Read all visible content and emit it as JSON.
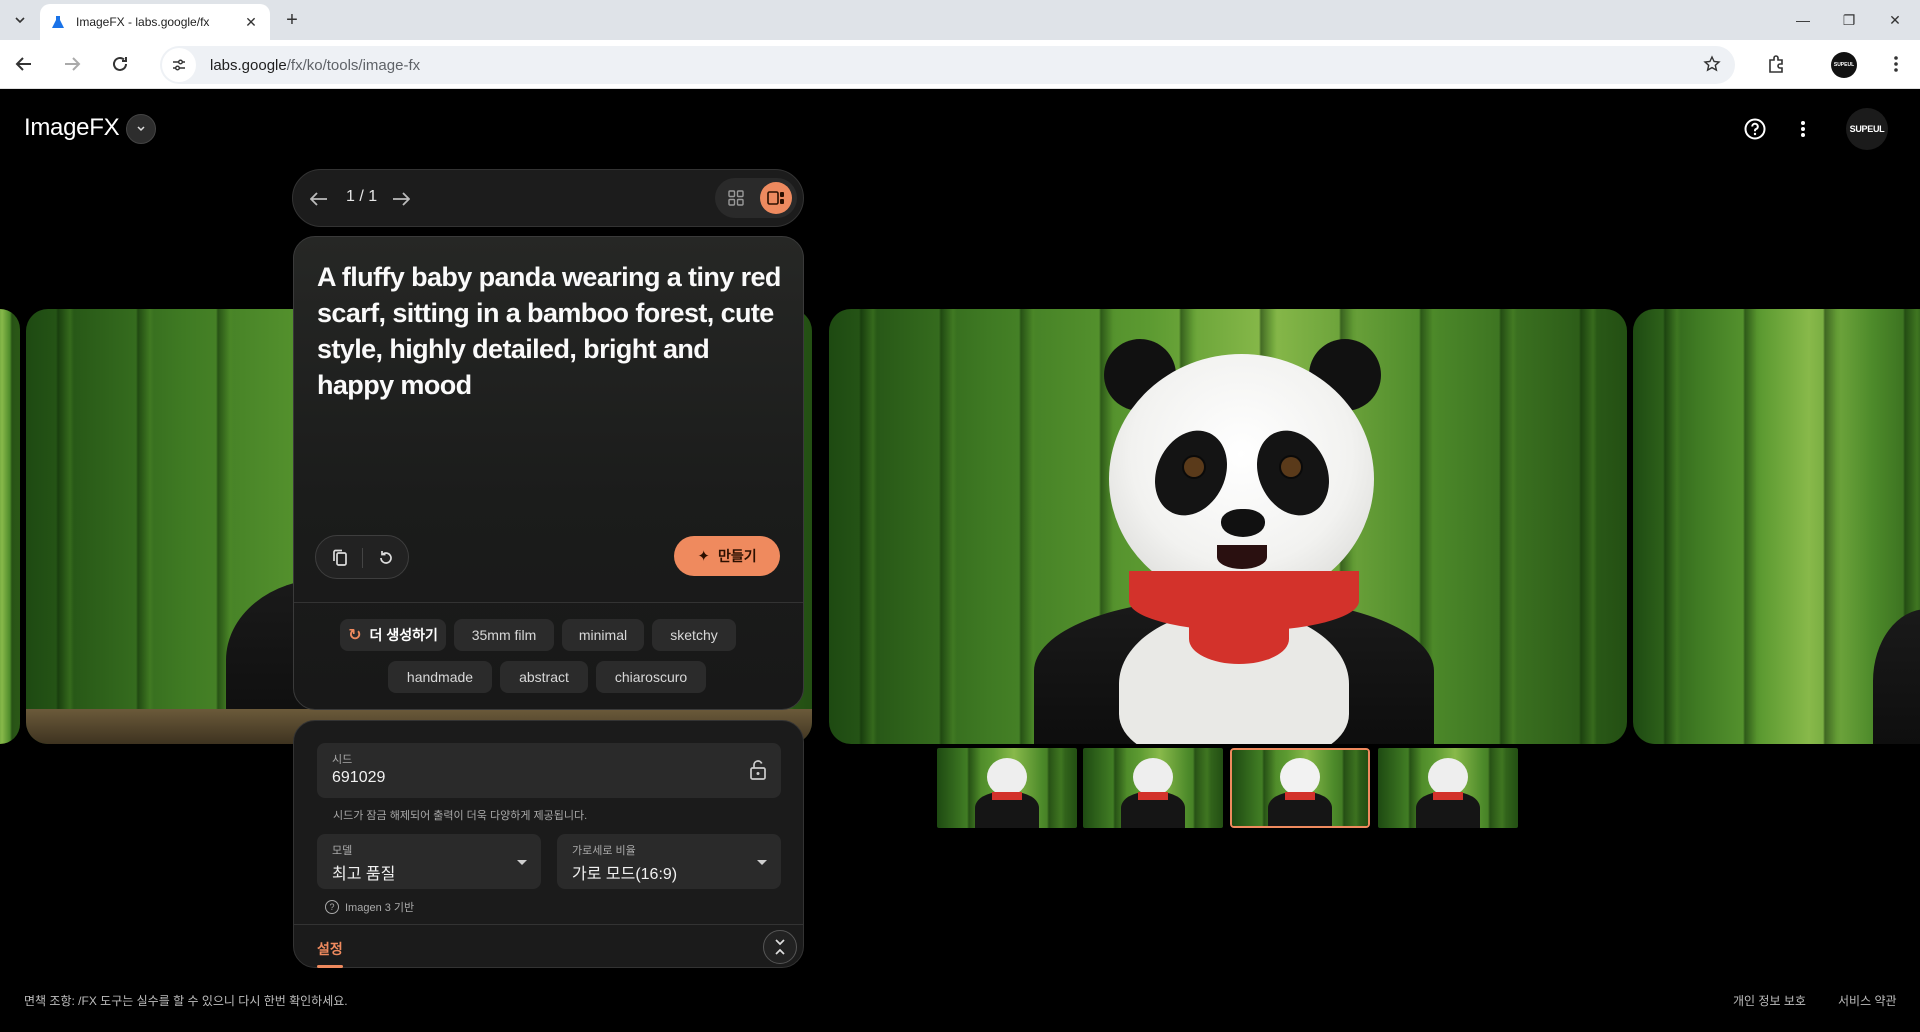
{
  "browser": {
    "tab_title": "ImageFX - labs.google/fx",
    "url_host": "labs.google",
    "url_path": "/fx/ko/tools/image-fx",
    "profile_text": "SUPEUL"
  },
  "header": {
    "app_name": "ImageFX",
    "avatar_text": "SUPEUL"
  },
  "pager": {
    "count": "1 / 1"
  },
  "prompt": {
    "text": "A fluffy baby panda wearing a tiny red scarf, sitting in a bamboo forest, cute style, highly detailed, bright and happy mood",
    "make_label": "만들기"
  },
  "chips": {
    "regen_label": "더 생성하기",
    "items": [
      "35mm film",
      "minimal",
      "sketchy",
      "handmade",
      "abstract",
      "chiaroscuro"
    ]
  },
  "settings": {
    "seed_label": "시드",
    "seed_value": "691029",
    "seed_helper": "시드가 잠금 해제되어 출력이 더욱 다양하게 제공됩니다.",
    "model_label": "모델",
    "model_value": "최고 품질",
    "aspect_label": "가로세로 비율",
    "aspect_value": "가로 모드(16:9)",
    "model_note": "Imagen 3 기반",
    "tab_label": "설정"
  },
  "thumbnails": {
    "count": 4,
    "selected_index": 2
  },
  "footer": {
    "disclaimer": "면책 조항: /FX 도구는 실수를 할 수 있으니 다시 한번 확인하세요.",
    "privacy": "개인 정보 보호",
    "terms": "서비스 약관"
  },
  "colors": {
    "accent": "#ef8a5e",
    "background": "#000000",
    "panel": "#1b1b1b"
  }
}
